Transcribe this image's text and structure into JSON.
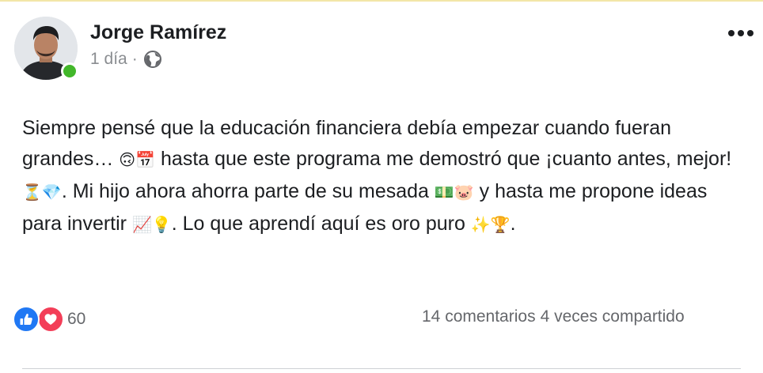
{
  "post": {
    "author": "Jorge Ramírez",
    "time": "1 día",
    "separator": "·",
    "audience_icon": "globe-icon",
    "body": {
      "part1": "Siempre pensé que la educación financiera debía empezar cuando fueran grandes… ",
      "emoji1": "🙃📅",
      "part2": " hasta que este programa me demostró que ¡cuanto antes, mejor! ",
      "emoji2": "⏳💎",
      "part3": ". Mi hijo ahora ahorra parte de su mesada ",
      "emoji3": "💵🐷",
      "part4": " y hasta me propone ideas para invertir ",
      "emoji4": "📈💡",
      "part5": ". Lo que aprendí aquí es oro puro ",
      "emoji5": "✨🏆",
      "part6": "."
    }
  },
  "reactions": {
    "icons": [
      "like-icon",
      "love-icon"
    ],
    "count": "60"
  },
  "stats": {
    "comments": "14 comentarios",
    "shares": "4 veces compartido"
  },
  "colors": {
    "like": "#2078f4",
    "love": "#f33e58",
    "online": "#42b72a",
    "secondary_text": "#65676b"
  }
}
